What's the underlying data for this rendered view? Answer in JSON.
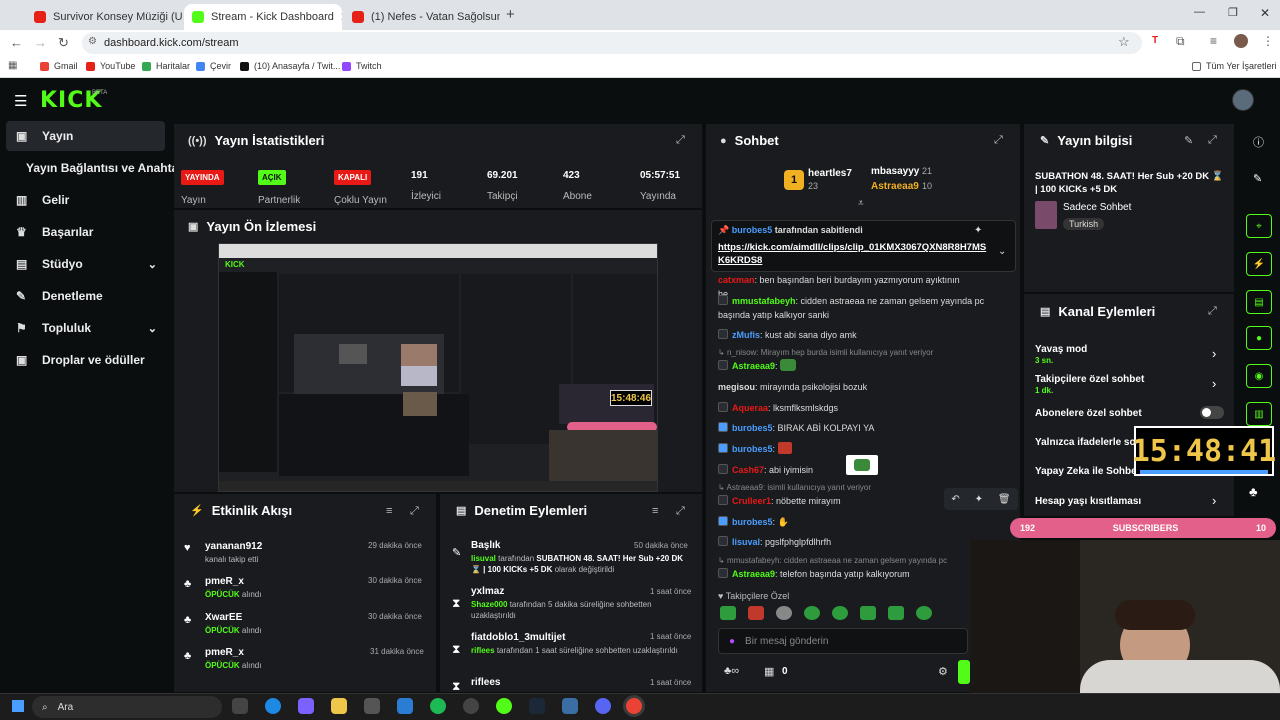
{
  "browser": {
    "tabs": [
      {
        "label": "Survivor Konsey Müziği (Uzun V",
        "color": "#e62117"
      },
      {
        "label": "Stream - Kick Dashboard",
        "color": "#53fc18"
      },
      {
        "label": "(1) Nefes - Vatan Sağolsun | Mi",
        "color": "#e62117"
      }
    ],
    "new_tab": "+",
    "url": "dashboard.kick.com/stream",
    "bookmarks": [
      {
        "label": "Gmail",
        "color": "#ea4335"
      },
      {
        "label": "YouTube",
        "color": "#e62117"
      },
      {
        "label": "Haritalar",
        "color": "#34a853"
      },
      {
        "label": "Çevir",
        "color": "#4285f4"
      },
      {
        "label": "(10) Anasayfa / Twit...",
        "color": "#111111"
      },
      {
        "label": "Twitch",
        "color": "#9146ff"
      }
    ],
    "all_bookmarks": "Tüm Yer İşaretleri"
  },
  "kick": {
    "logo": "KICK",
    "beta": "BETA"
  },
  "sidebar": {
    "items": [
      {
        "label": "Yayın",
        "icon": "broadcast-icon"
      },
      {
        "label": "Yayın Bağlantısı ve Anahtarı",
        "icon": "key-icon"
      },
      {
        "label": "Gelir",
        "icon": "chart-icon"
      },
      {
        "label": "Başarılar",
        "icon": "trophy-icon"
      },
      {
        "label": "Stüdyo",
        "icon": "studio-icon"
      },
      {
        "label": "Denetleme",
        "icon": "wrench-icon"
      },
      {
        "label": "Topluluk",
        "icon": "community-icon"
      },
      {
        "label": "Droplar ve ödüller",
        "icon": "drops-icon"
      }
    ]
  },
  "stats": {
    "title": "Yayın İstatistikleri",
    "items": [
      {
        "badge": "YAYINDA",
        "label": "Yayın",
        "badge_color": "#e91916"
      },
      {
        "badge": "AÇIK",
        "label": "Partnerlik",
        "badge_color": "#53fc18"
      },
      {
        "badge": "KAPALI",
        "label": "Çoklu Yayın",
        "badge_color": "#e91916"
      },
      {
        "value": "191",
        "label": "İzleyici"
      },
      {
        "value": "69.201",
        "label": "Takipçi"
      },
      {
        "value": "423",
        "label": "Abone"
      },
      {
        "value": "05:57:51",
        "label": "Yayında"
      }
    ]
  },
  "preview": {
    "title": "Yayın Ön İzlemesi",
    "timer": "15:48:46"
  },
  "activity": {
    "title": "Etkinlik Akışı",
    "items": [
      {
        "name": "yananan912",
        "sub": "kanalı takip etti",
        "time": "29 dakika önce"
      },
      {
        "name": "pmeR_x",
        "sub_hl": "ÖPÜCÜK",
        "sub": "alındı",
        "time": "30 dakika önce"
      },
      {
        "name": "XwarEE",
        "sub_hl": "ÖPÜCÜK",
        "sub": "alındı",
        "time": "30 dakika önce"
      },
      {
        "name": "pmeR_x",
        "sub_hl": "ÖPÜCÜK",
        "sub": "alındı",
        "time": "31 dakika önce"
      }
    ]
  },
  "moderation": {
    "title": "Denetim Eylemleri",
    "items": [
      {
        "name": "Başlık",
        "time": "50 dakika önce",
        "user": "lisuval",
        "text": "tarafından",
        "bold": "SUBATHON 48. SAAT! Her Sub +20 DK ⌛ | 100 KICKs +5 DK",
        "tail": "olarak değiştirildi"
      },
      {
        "name": "yxlmaz",
        "time": "1 saat önce",
        "user": "Shaze000",
        "text": "tarafından 5 dakika süreliğine sohbetten uzaklaştırıldı"
      },
      {
        "name": "fiatdoblo1_3multijet",
        "time": "1 saat önce",
        "user": "riflees",
        "text": "tarafından 1 saat süreliğine sohbetten uzaklaştırıldı"
      },
      {
        "name": "riflees",
        "time": "1 saat önce"
      }
    ]
  },
  "chat": {
    "title": "Sohbet",
    "leaders": [
      {
        "name": "heartles7",
        "count": "23",
        "rank": "1"
      },
      {
        "name": "mbasayyy",
        "count": "21"
      },
      {
        "name": "Astraeaa9",
        "count": "10"
      }
    ],
    "pinned_by": "burobes5",
    "pinned_label": "tarafından sabitlendi",
    "pinned_link": "https://kick.com/aimdll/clips/clip_01KMX3067QXN8R8H7MSK6KRDS8",
    "messages": [
      {
        "user": "catxman",
        "color": "#e91916",
        "text": "ben başından beri burdayım yazmıyorum ayıktının he"
      },
      {
        "user": "mmustafabeyh",
        "color": "#53fc18",
        "text": "cidden astraeaa ne zaman gelsem yayında pc başında yatıp kalkıyor sanki"
      },
      {
        "user": "zMufis",
        "color": "#4a9eff",
        "text": "kust abi sana diyo amk"
      },
      {
        "reply": "n_nisow: Mirayım hep burda isimli kullanıcıya yanıt veriyor",
        "user": "Astraeaa9",
        "color": "#53fc18",
        "text": ""
      },
      {
        "user": "megisou",
        "color": "#dddddd",
        "text": "mirayında psikolojisi bozuk"
      },
      {
        "user": "Aqueraa",
        "color": "#e91916",
        "text": "lksmflksmlskdgs"
      },
      {
        "user": "burobes5",
        "color": "#4a9eff",
        "text": "BIRAK ABİ KOLPAYI YA"
      },
      {
        "user": "burobes5",
        "color": "#4a9eff",
        "text": ""
      },
      {
        "user": "Cash67",
        "color": "#e91916",
        "text": "abi iyimisin"
      },
      {
        "reply": "Astraeaa9: isimli kullanıcıya yanıt veriyor",
        "user": "Crulleer1",
        "color": "#e91916",
        "text": "nöbette mirayım"
      },
      {
        "user": "burobes5",
        "color": "#4a9eff",
        "text": ""
      },
      {
        "user": "lisuval",
        "color": "#4a9eff",
        "text": "pgslfphglpfdlhrfh"
      },
      {
        "reply": "mmustafabeyh: cidden astraeaa ne zaman gelsem yayında pc",
        "user": "Astraeaa9",
        "color": "#53fc18",
        "text": "telefon başında yatıp kalkıyorum"
      }
    ],
    "followers_only": "Takipçilere Özel",
    "input_placeholder": "Bir mesaj gönderin",
    "points": "0"
  },
  "info": {
    "title": "Yayın bilgisi",
    "stream_title": "SUBATHON 48. SAAT! Her Sub +20 DK ⌛ | 100 KICKs +5 DK",
    "category": "Sadece Sohbet",
    "tag": "Turkish"
  },
  "channel_actions": {
    "title": "Kanal Eylemleri",
    "items": [
      {
        "label": "Yavaş mod",
        "sub": "3 sn."
      },
      {
        "label": "Takipçilere özel sohbet",
        "sub": "1 dk."
      },
      {
        "label": "Abonelere özel sohbet"
      },
      {
        "label": "Yalnızca ifadelerle sohbet"
      },
      {
        "label": "Yapay Zeka ile Sohbet"
      },
      {
        "label": "Hesap yaşı kısıtlaması"
      }
    ]
  },
  "overlay": {
    "clock": "15:48:41",
    "sub_count": "192",
    "sub_label": "SUBSCRIBERS",
    "sub_goal": "10"
  },
  "taskbar": {
    "search": "Ara"
  }
}
